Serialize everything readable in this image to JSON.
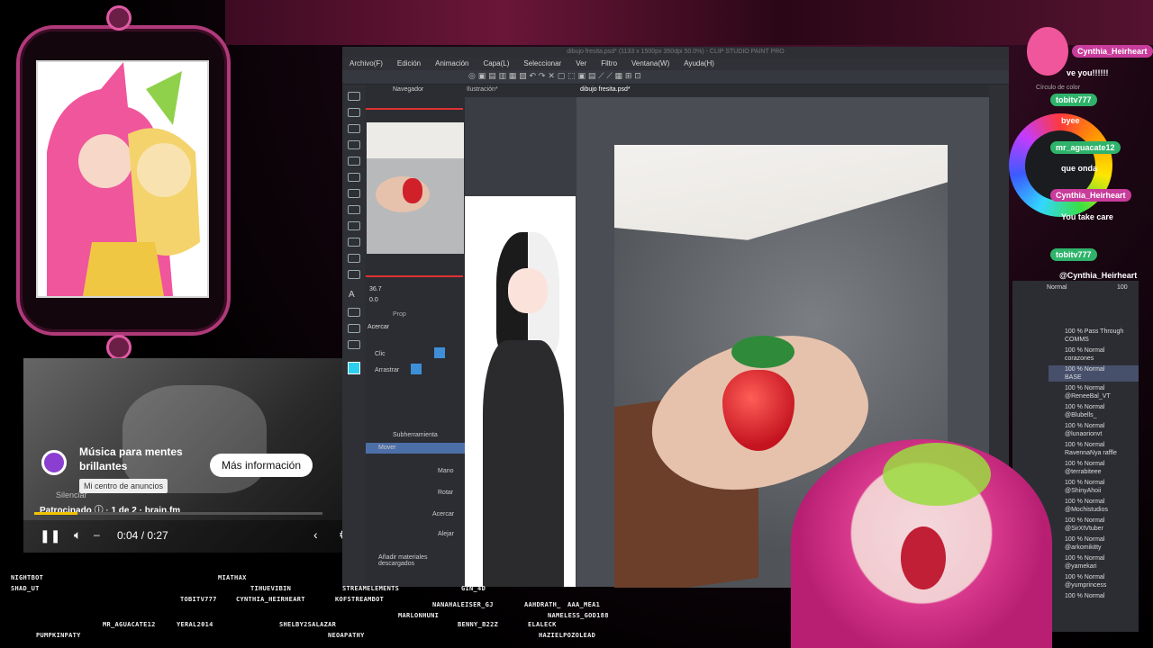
{
  "csp": {
    "title": "dibujo fresita.psd* (1133 x 1500px 350dpi 50.0%) - CLIP STUDIO PAINT PRO",
    "menu": [
      "Archivo(F)",
      "Edición",
      "Animación",
      "Capa(L)",
      "Seleccionar",
      "Ver",
      "Filtro",
      "Ventana(W)",
      "Ayuda(H)"
    ],
    "navigator_label": "Navegador",
    "illustration_tab": "Ilustración*",
    "canvas_tab": "dibujo fresita.psd*",
    "zoom_value": "36.7",
    "rotate_value": "0.0",
    "prop_label": "Prop",
    "acercar_label": "Acercar",
    "clic_label": "Clic",
    "arrastrar_label": "Arrastrar",
    "subtool_header": "Subherramienta",
    "subtools": [
      "Mover",
      "Mano",
      "Rotar",
      "Acercar",
      "Alejar"
    ],
    "download_label": "Añadir materiales descargados",
    "color_circle_label": "Círculo de color",
    "blend_mode": "Normal",
    "opacity": "100",
    "layers": [
      {
        "mode": "100 % Pass Through",
        "name": "COMMS"
      },
      {
        "mode": "100 % Normal",
        "name": "corazones"
      },
      {
        "mode": "100 % Normal",
        "name": "BASE"
      },
      {
        "mode": "100 % Normal",
        "name": "@ReneeBal_VT"
      },
      {
        "mode": "100 % Normal",
        "name": "@Blubells_"
      },
      {
        "mode": "100 % Normal",
        "name": "@lunaorionvt"
      },
      {
        "mode": "100 % Normal",
        "name": "RavennaNya raffle"
      },
      {
        "mode": "100 % Normal",
        "name": "@terrabiteee"
      },
      {
        "mode": "100 % Normal",
        "name": "@ShinyAhoii"
      },
      {
        "mode": "100 % Normal",
        "name": "@Mochistudios"
      },
      {
        "mode": "100 % Normal",
        "name": "@SirXtVtuber"
      },
      {
        "mode": "100 % Normal",
        "name": "@arkomikitty"
      },
      {
        "mode": "100 % Normal",
        "name": "@yamekari"
      },
      {
        "mode": "100 % Normal",
        "name": "@yumprincess"
      },
      {
        "mode": "100 % Normal",
        "name": ""
      }
    ]
  },
  "ad": {
    "title": "Música para mentes brillantes",
    "more_info": "Más información",
    "tooltip": "Mi centro de anuncios",
    "mute": "Silenciar",
    "sponsored": "Patrocinado",
    "position": "1 de 2",
    "brand": "brain.fm",
    "time": "0:04 / 0:27",
    "progress": 0.15
  },
  "chat": {
    "header_user": "Cynthia_Heirheart",
    "snippet": "ve you!!!!!!",
    "messages": [
      {
        "user": "tobitv777",
        "text": "byee",
        "color": "green"
      },
      {
        "user": "mr_aguacate12",
        "text": "que onda",
        "color": "green"
      },
      {
        "user": "Cynthia_Heirheart",
        "text": "You take care",
        "color": "pink"
      },
      {
        "user": "tobitv777",
        "text": "@Cynthia_Heirheart take",
        "color": "green"
      }
    ]
  },
  "credits": {
    "row1": [
      "NIGHTBOT",
      "MIATHAX"
    ],
    "row2": [
      "SHAD_UT",
      "TOBITV777",
      "CYNTHIA_HEIRHEART",
      "TIHUEVIBIN",
      "STREAMELEMENTS",
      "KOFSTREAMBOT",
      "GIN_4D"
    ],
    "row3": [
      "NANAHALEISER_GJ",
      "AAHDRATH_",
      "AAA_MEA1",
      "MARLONHUNI",
      "NAMELESS_GOD188"
    ],
    "row4": [
      "PUMPKINPATY",
      "MR_AGUACATE12",
      "YERAL2014",
      "SHELBY2SALAZAR",
      "NEOAPATHY",
      "BENNY_B22Z",
      "ELALECK",
      "HAZIELPOZOLEAD"
    ]
  },
  "colors": {
    "accent_pink": "#c83c9b",
    "chat_green": "#2fb36b",
    "ad_progress": "#f2c400"
  }
}
